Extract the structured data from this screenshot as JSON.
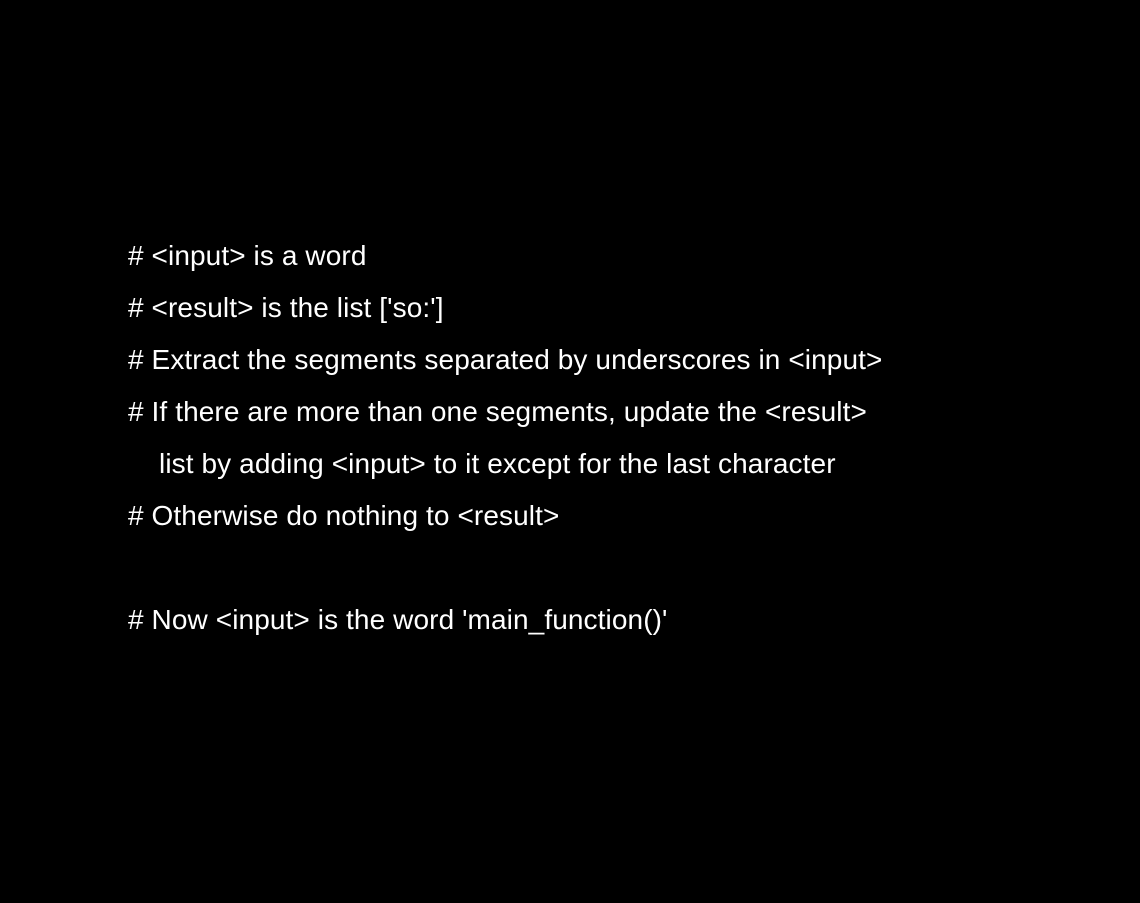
{
  "document": {
    "lines": [
      "# <input> is a word",
      "# <result> is the list ['so:']",
      "# Extract the segments separated by underscores in <input>",
      "# If there are more than one segments, update the <result>",
      "list by adding <input> to it except for the last character",
      "# Otherwise do nothing to <result>",
      "",
      "# Now <input> is the word 'main_function()'"
    ]
  },
  "colors": {
    "background": "#000000",
    "text": "#ffffff"
  }
}
